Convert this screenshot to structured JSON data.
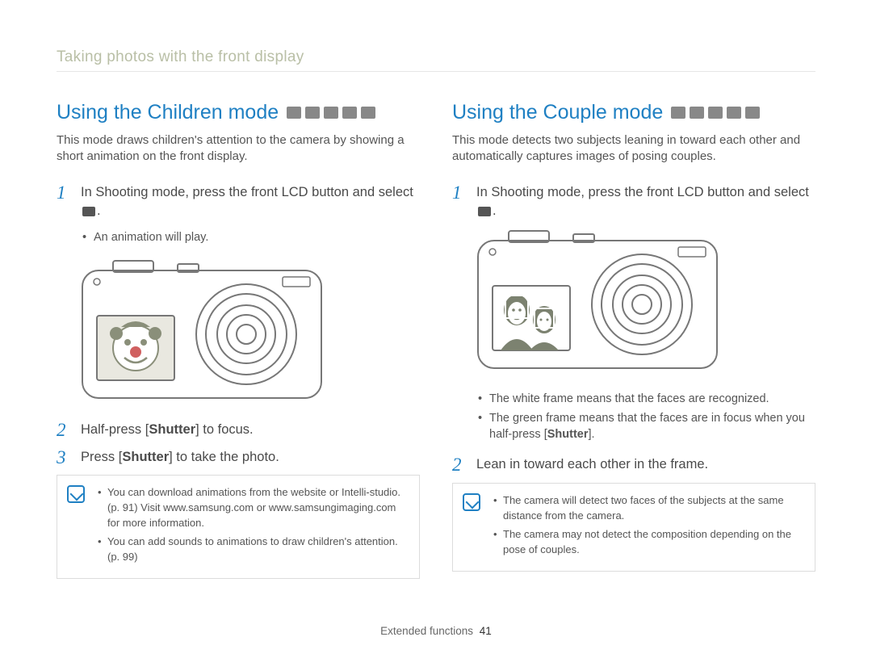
{
  "breadcrumb": "Taking photos with the front display",
  "footer": {
    "section": "Extended functions",
    "page": "41"
  },
  "left": {
    "heading": "Using the Children mode",
    "heading_icons": [
      "smart-icon",
      "camera-icon",
      "camera-plus-icon",
      "scene-icon",
      "dual-icon"
    ],
    "intro": "This mode draws children's attention to the camera by showing a short animation on the front display.",
    "step1_a": "In Shooting mode, press the front LCD button and select ",
    "step1_b": ".",
    "step1_sub": [
      "An animation will play."
    ],
    "step2_a": "Half-press [",
    "step2_bold": "Shutter",
    "step2_b": "] to focus.",
    "step3_a": "Press [",
    "step3_bold": "Shutter",
    "step3_b": "] to take the photo.",
    "note": [
      "You can download animations from the website or Intelli-studio. (p. 91) Visit www.samsung.com or www.samsungimaging.com for more information.",
      "You can add sounds to animations to draw children's attention. (p. 99)"
    ]
  },
  "right": {
    "heading": "Using the Couple mode",
    "heading_icons": [
      "smart-icon",
      "camera-icon",
      "camera-plus-icon",
      "scene-icon",
      "dual-icon"
    ],
    "intro": "This mode detects two subjects leaning in toward each other and automatically captures images of posing couples.",
    "step1_a": "In Shooting mode, press the front LCD button and select ",
    "step1_b": ".",
    "step1_sub": [
      "The white frame means that the faces are recognized.",
      "The green frame means that the faces are in focus when you half-press [__SHUTTER__]."
    ],
    "step1_sub_bold": "Shutter",
    "step2": "Lean in toward each other in the frame.",
    "note": [
      "The camera will detect two faces of the subjects at the same distance from the camera.",
      "The camera may not detect the composition depending on the pose of couples."
    ]
  }
}
